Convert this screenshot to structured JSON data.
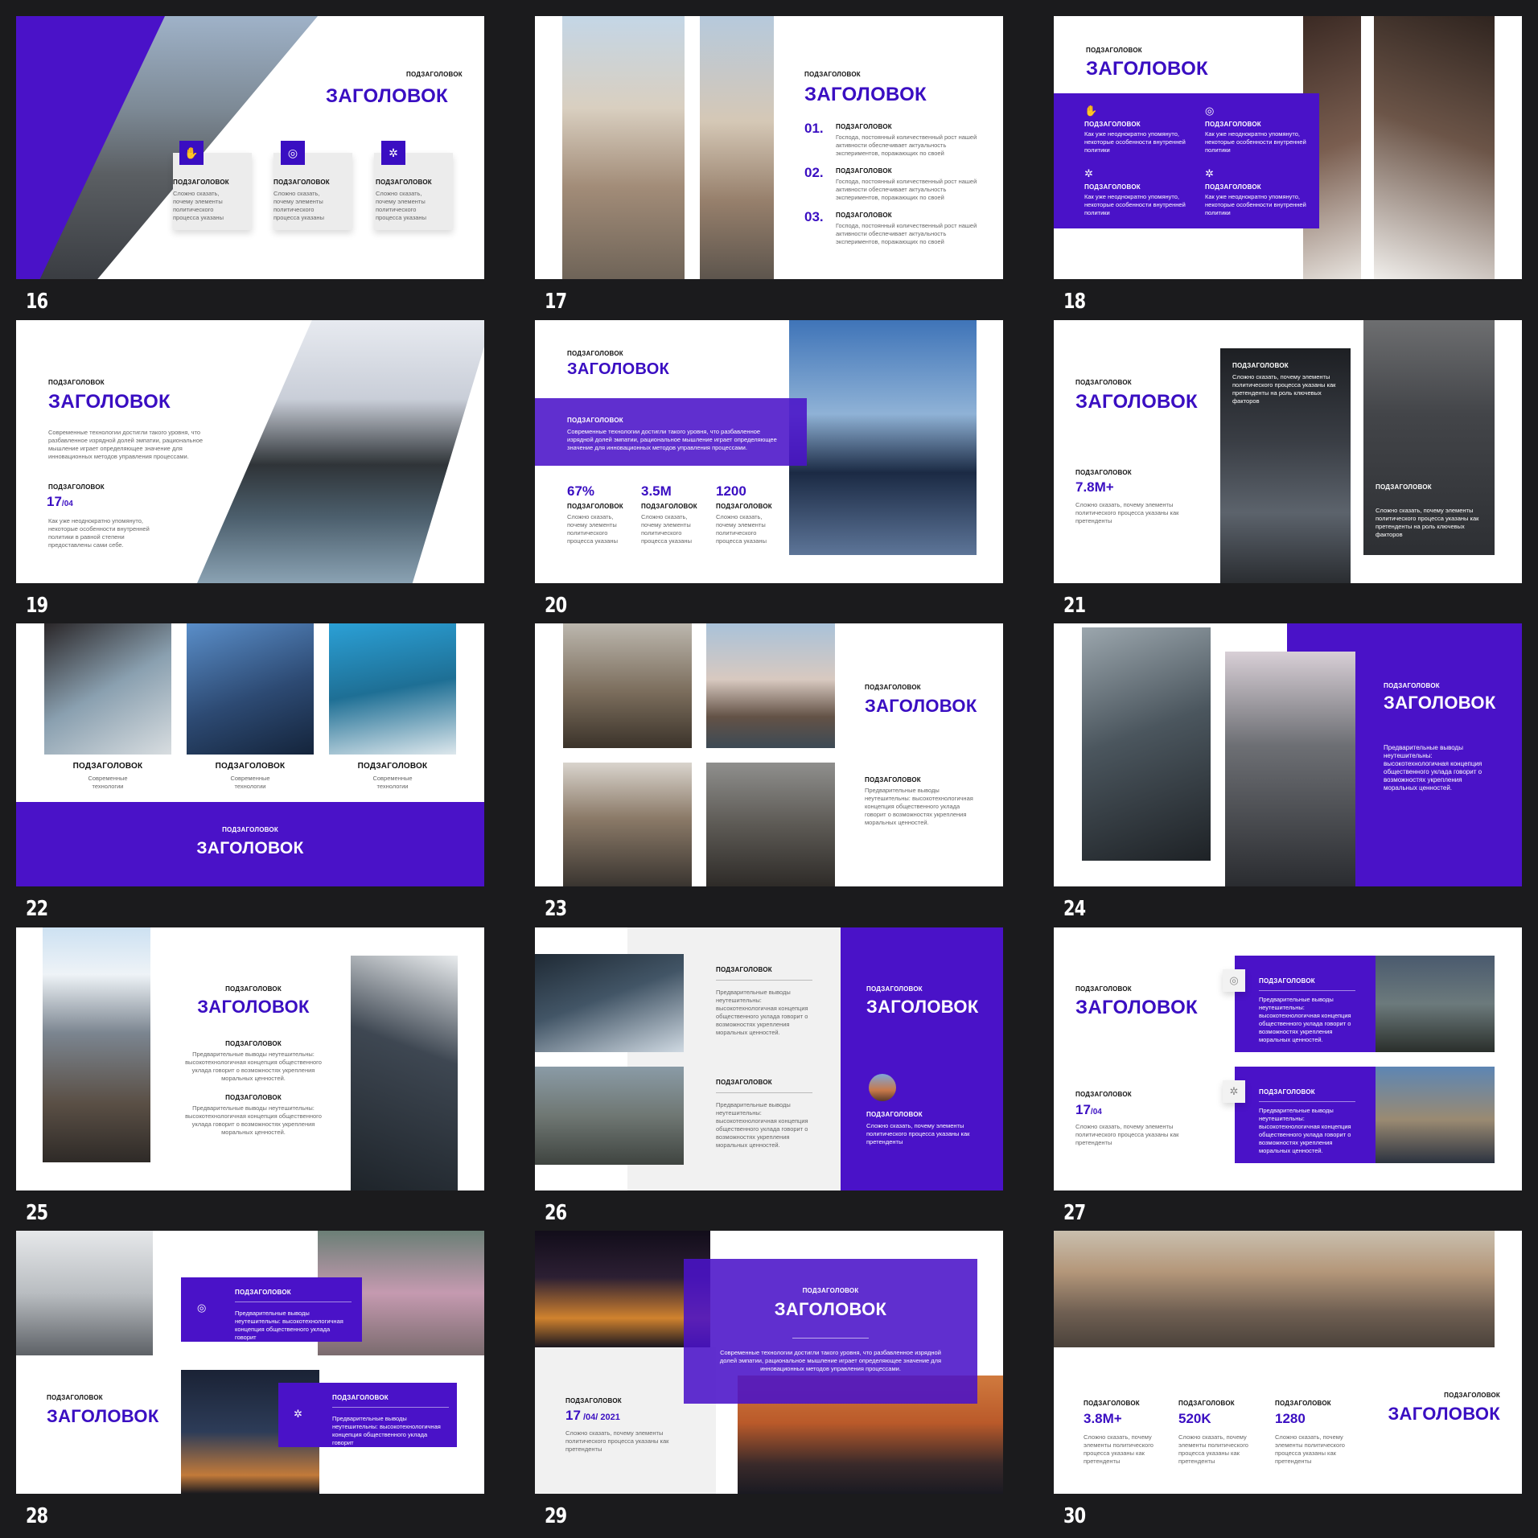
{
  "slide_numbers": [
    "16",
    "17",
    "18",
    "19",
    "20",
    "21",
    "22",
    "23",
    "24",
    "25",
    "26",
    "27",
    "28",
    "29",
    "30"
  ],
  "common": {
    "subtitle": "ПОДЗАГОЛОВОК",
    "title": "ЗАГОЛОВОК"
  },
  "s16": {
    "cards": [
      {
        "label": "ПОДЗАГОЛОВОК",
        "text": "Сложно сказать, почему элементы политического процесса указаны",
        "icon": "hand-icon"
      },
      {
        "label": "ПОДЗАГОЛОВОК",
        "text": "Сложно сказать, почему элементы политического процесса указаны",
        "icon": "target-icon"
      },
      {
        "label": "ПОДЗАГОЛОВОК",
        "text": "Сложно сказать, почему элементы политического процесса указаны",
        "icon": "network-icon"
      }
    ]
  },
  "s17": {
    "items": [
      {
        "num": "01.",
        "label": "ПОДЗАГОЛОВОК",
        "text": "Господа, постоянный количественный рост нашей активности обеспечивает актуальность экспериментов, поражающих по своей"
      },
      {
        "num": "02.",
        "label": "ПОДЗАГОЛОВОК",
        "text": "Господа, постоянный количественный рост нашей активности обеспечивает актуальность экспериментов, поражающих по своей"
      },
      {
        "num": "03.",
        "label": "ПОДЗАГОЛОВОК",
        "text": "Господа, постоянный количественный рост нашей активности обеспечивает актуальность экспериментов, поражающих по своей"
      }
    ]
  },
  "s18": {
    "text": "Как уже неоднократно упомянуто, некоторые особенности внутренней политики"
  },
  "s19": {
    "body": "Современные технологии достигли такого уровня, что разбавленное изрядной долей эмпатии, рациональное мышление играет определяющее значение для инновационных методов управления процессами.",
    "date_day": "17",
    "date_month": "/04",
    "text": "Как уже неоднократно упомянуто, некоторые особенности внутренней политики в равной степени предоставлены сами себе."
  },
  "s20": {
    "body": "Современные технологии достигли такого уровня, что разбавленное изрядной долей эмпатии, рациональное мышление играет определяющее значение для инновационных методов управления процессами.",
    "stats": [
      {
        "value": "67%",
        "label": "ПОДЗАГОЛОВОК",
        "text": "Сложно сказать, почему элементы политического процесса указаны"
      },
      {
        "value": "3.5M",
        "label": "ПОДЗАГОЛОВОК",
        "text": "Сложно сказать, почему элементы политического процесса указаны"
      },
      {
        "value": "1200",
        "label": "ПОДЗАГОЛОВОК",
        "text": "Сложно сказать, почему элементы политического процесса указаны"
      }
    ]
  },
  "s21": {
    "value": "7.8M+",
    "text": "Сложно сказать, почему элементы политического процесса указаны как претенденты",
    "card_text": "Сложно сказать, почему элементы политического процесса указаны как претенденты на роль ключевых факторов"
  },
  "s22": {
    "caption": "Современные технологии"
  },
  "s23": {
    "text": "Предварительные выводы неутешительны: высокотехнологичная концепция общественного уклада говорит о возможностях укрепления моральных ценностей."
  },
  "s24": {
    "text": "Предварительные выводы неутешительны: высокотехнологичная концепция общественного уклада говорит о возможностях укрепления моральных ценностей."
  },
  "s25": {
    "text": "Предварительные выводы неутешительны: высокотехнологичная концепция общественного уклада говорит о возможностях укрепления моральных ценностей."
  },
  "s26": {
    "text": "Предварительные выводы неутешительны: высокотехнологичная концепция общественного уклада говорит о возможностях укрепления моральных ценностей.",
    "side_text": "Сложно сказать, почему элементы политического процесса указаны как претенденты"
  },
  "s27": {
    "date_day": "17",
    "date_month": "/04",
    "text": "Сложно сказать, почему элементы политического процесса указаны как претенденты",
    "card_text": "Предварительные выводы неутешительны: высокотехнологичная концепция общественного уклада говорит о возможностях укрепления моральных ценностей."
  },
  "s28": {
    "card_text": "Предварительные выводы неутешительны: высокотехнологичная концепция общественного уклада говорит"
  },
  "s29": {
    "body": "Современные технологии достигли такого уровня, что разбавленное изрядной долей эмпатии, рациональное мышление играет определяющее значение для инновационных методов управления процессами.",
    "date_day": "17",
    "date_rest": " /04/ 2021",
    "text": "Сложно сказать, почему элементы политического процесса указаны как претенденты"
  },
  "s30": {
    "stats": [
      {
        "value": "3.8M+",
        "label": "ПОДЗАГОЛОВОК",
        "text": "Сложно сказать, почему элементы политического процесса указаны как претенденты"
      },
      {
        "value": "520K",
        "label": "ПОДЗАГОЛОВОК",
        "text": "Сложно сказать, почему элементы политического процесса указаны как претенденты"
      },
      {
        "value": "1280",
        "label": "ПОДЗАГОЛОВОК",
        "text": "Сложно сказать, почему элементы политического процесса указаны как претенденты"
      }
    ]
  },
  "colors": {
    "accent": "#3a0ec2",
    "background": "#1b1b1d",
    "card": "#ececec"
  }
}
